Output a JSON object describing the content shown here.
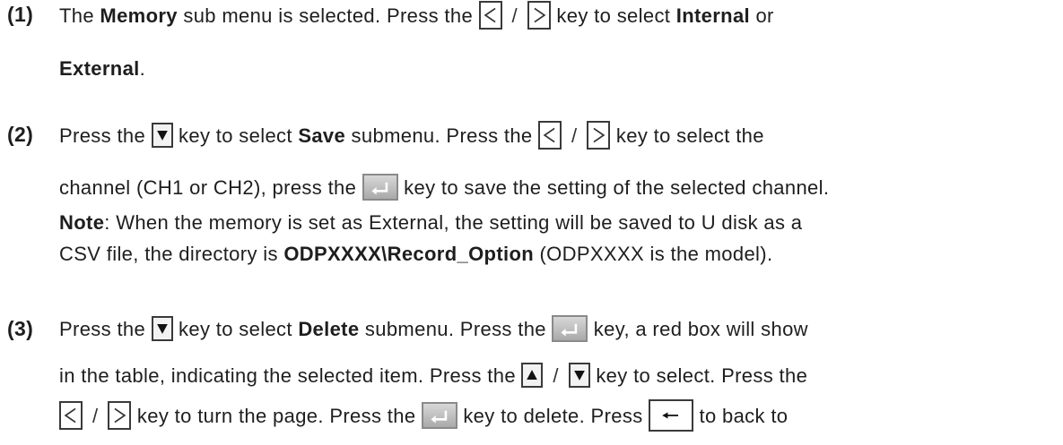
{
  "items": [
    {
      "number": "(1)",
      "lines": [
        [
          "The ",
          {
            "b": "Memory"
          },
          " sub menu is selected. Press the ",
          {
            "key": "left"
          },
          {
            "slash": "/"
          },
          {
            "key": "right"
          },
          " key to select ",
          {
            "b": "Internal"
          },
          " or"
        ],
        [
          {
            "b": "External"
          },
          "."
        ]
      ]
    },
    {
      "number": "(2)",
      "lines": [
        [
          "Press the ",
          {
            "key": "down"
          },
          " key to select ",
          {
            "b": "Save"
          },
          " submenu. Press the ",
          {
            "key": "left"
          },
          {
            "slash": "/"
          },
          {
            "key": "right"
          },
          " key to select the"
        ],
        [
          "channel (CH1 or CH2), press the ",
          {
            "key": "enter"
          },
          " key to save the setting of the selected channel."
        ],
        [
          {
            "b": "Note"
          },
          ": When the memory is set as External, the setting will be saved to U disk as a"
        ],
        [
          "CSV file, the directory is ",
          {
            "b": "ODPXXXX\\Record_Option"
          },
          " (ODPXXXX is the model)."
        ]
      ]
    },
    {
      "number": "(3)",
      "lines": [
        [
          "Press the ",
          {
            "key": "down"
          },
          " key to select ",
          {
            "b": "Delete"
          },
          " submenu. Press the ",
          {
            "key": "enter"
          },
          " key, a red box will show"
        ],
        [
          " in the table, indicating the selected item. Press the ",
          {
            "key": "up"
          },
          {
            "slash": " / "
          },
          {
            "key": "down"
          },
          " key to select. Press the"
        ],
        [
          {
            "key": "left"
          },
          {
            "slash": "/"
          },
          {
            "key": "right"
          },
          " key to turn the page. Press the ",
          {
            "key": "enter"
          },
          " key to delete. Press ",
          {
            "key": "back"
          },
          " to back to"
        ]
      ]
    }
  ],
  "icons": {
    "left": "less-than-key-icon",
    "right": "greater-than-key-icon",
    "up": "up-arrow-key-icon",
    "down": "down-arrow-key-icon",
    "enter": "enter-key-icon",
    "back": "back-key-icon"
  }
}
